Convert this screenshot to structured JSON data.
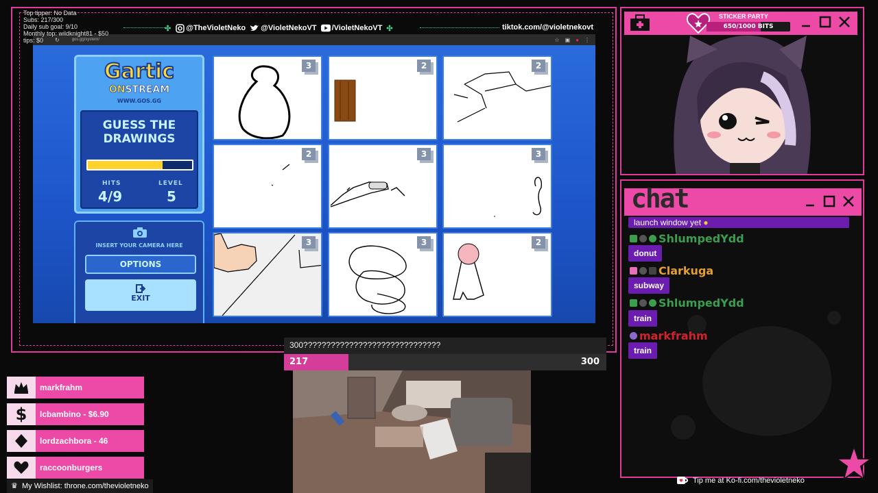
{
  "stats": {
    "lines": [
      "Top tipper: No Data",
      "Subs: 217/300",
      "Daily sub goal: 9/10",
      "Monthly top: wildknight81 - $50",
      "tips: $0"
    ]
  },
  "socials": {
    "instagram": "@TheVioletNeko",
    "twitter": "@VioletNekoVT",
    "youtube": "/VioletNekoVT",
    "tiktok": "tiktok.com/@violetnekovt"
  },
  "browser": {
    "url": "gos.gg/system/"
  },
  "game": {
    "logo": "Gartic",
    "logo_on": "ON",
    "logo_stream": "STREAM",
    "logo_url": "WWW.GOS.GG",
    "guess_title": "GUESS THE DRAWINGS",
    "progress": 0.72,
    "hits_label": "HITS",
    "hits_value": "4/9",
    "level_label": "LEVEL",
    "level_value": "5",
    "camera_text": "INSERT YOUR CAMERA HERE",
    "options_label": "OPTIONS",
    "exit_label": "EXIT",
    "cards": [
      {
        "badge": "3"
      },
      {
        "badge": "2"
      },
      {
        "badge": "2"
      },
      {
        "badge": "2"
      },
      {
        "badge": "3"
      },
      {
        "badge": "3"
      },
      {
        "badge": "3"
      },
      {
        "badge": "3"
      },
      {
        "badge": "2"
      }
    ]
  },
  "goal": {
    "title": "300??????????????????????????????",
    "current": "217",
    "max": "300",
    "fraction": 0.2
  },
  "labels": [
    {
      "icon": "crown-icon",
      "text": "markfrahm"
    },
    {
      "icon": "dollar-icon",
      "text": "lcbambino - $6.90"
    },
    {
      "icon": "diamond-icon",
      "text": "lordzachbora - 46"
    },
    {
      "icon": "heart-icon",
      "text": "raccoonburgers"
    }
  ],
  "wishlist": "My Wishlist: throne.com/thevioletneko",
  "sticker": {
    "title": "STICKER PARTY",
    "value": "650/1000 BITS",
    "fraction": 0.65
  },
  "chat": {
    "title": "chat",
    "partial_msg": "launch window yet",
    "messages": [
      {
        "user": "ShlumpedYdd",
        "color": "#3b9e4f",
        "text": "donut"
      },
      {
        "user": "Clarkuga",
        "color": "#e6a02b",
        "text": "subway"
      },
      {
        "user": "ShlumpedYdd",
        "color": "#3b9e4f",
        "text": "train"
      },
      {
        "user": "markfrahm",
        "color": "#d0232c",
        "text": "train"
      }
    ]
  },
  "kofi": "Tip me at Ko-fi.com/thevioletneko",
  "colors": {
    "accent": "#ec4aa6",
    "chat_bubble": "#6a1dae",
    "game_bg": "#1d55c9"
  }
}
